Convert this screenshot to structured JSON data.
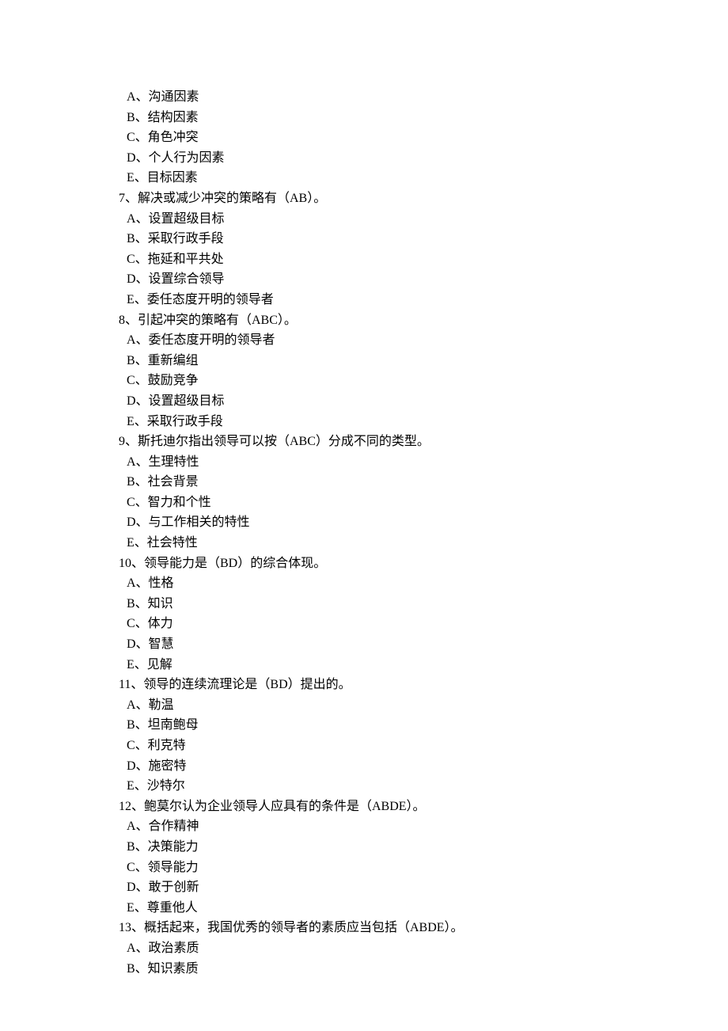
{
  "items": [
    {
      "type": "option",
      "text": "A、沟通因素"
    },
    {
      "type": "option",
      "text": "B、结构因素"
    },
    {
      "type": "option",
      "text": "C、角色冲突"
    },
    {
      "type": "option",
      "text": "D、个人行为因素"
    },
    {
      "type": "option",
      "text": "E、目标因素"
    },
    {
      "type": "question",
      "text": "7、解决或减少冲突的策略有（AB）。"
    },
    {
      "type": "option",
      "text": "A、设置超级目标"
    },
    {
      "type": "option",
      "text": "B、采取行政手段"
    },
    {
      "type": "option",
      "text": "C、拖延和平共处"
    },
    {
      "type": "option",
      "text": "D、设置综合领导"
    },
    {
      "type": "option",
      "text": "E、委任态度开明的领导者"
    },
    {
      "type": "question",
      "text": "8、引起冲突的策略有（ABC）。"
    },
    {
      "type": "option",
      "text": "A、委任态度开明的领导者"
    },
    {
      "type": "option",
      "text": "B、重新编组"
    },
    {
      "type": "option",
      "text": "C、鼓励竞争"
    },
    {
      "type": "option",
      "text": "D、设置超级目标"
    },
    {
      "type": "option",
      "text": "E、采取行政手段"
    },
    {
      "type": "question",
      "text": "9、斯托迪尔指出领导可以按（ABC）分成不同的类型。"
    },
    {
      "type": "option",
      "text": "A、生理特性"
    },
    {
      "type": "option",
      "text": "B、社会背景"
    },
    {
      "type": "option",
      "text": "C、智力和个性"
    },
    {
      "type": "option",
      "text": "D、与工作相关的特性"
    },
    {
      "type": "option",
      "text": "E、社会特性"
    },
    {
      "type": "question",
      "text": "10、领导能力是（BD）的综合体现。"
    },
    {
      "type": "option",
      "text": "A、性格"
    },
    {
      "type": "option",
      "text": "B、知识"
    },
    {
      "type": "option",
      "text": "C、体力"
    },
    {
      "type": "option",
      "text": "D、智慧"
    },
    {
      "type": "option",
      "text": "E、见解"
    },
    {
      "type": "question",
      "text": "11、领导的连续流理论是（BD）提出的。"
    },
    {
      "type": "option",
      "text": "A、勒温"
    },
    {
      "type": "option",
      "text": "B、坦南鲍母"
    },
    {
      "type": "option",
      "text": "C、利克特"
    },
    {
      "type": "option",
      "text": "D、施密特"
    },
    {
      "type": "option",
      "text": "E、沙特尔"
    },
    {
      "type": "question",
      "text": "12、鲍莫尔认为企业领导人应具有的条件是（ABDE）。"
    },
    {
      "type": "option",
      "text": "A、合作精神"
    },
    {
      "type": "option",
      "text": "B、决策能力"
    },
    {
      "type": "option",
      "text": "C、领导能力"
    },
    {
      "type": "option",
      "text": "D、敢于创新"
    },
    {
      "type": "option",
      "text": "E、尊重他人"
    },
    {
      "type": "question",
      "text": "13、概括起来，我国优秀的领导者的素质应当包括（ABDE）。"
    },
    {
      "type": "option",
      "text": "A、政治素质"
    },
    {
      "type": "option",
      "text": "B、知识素质"
    }
  ]
}
